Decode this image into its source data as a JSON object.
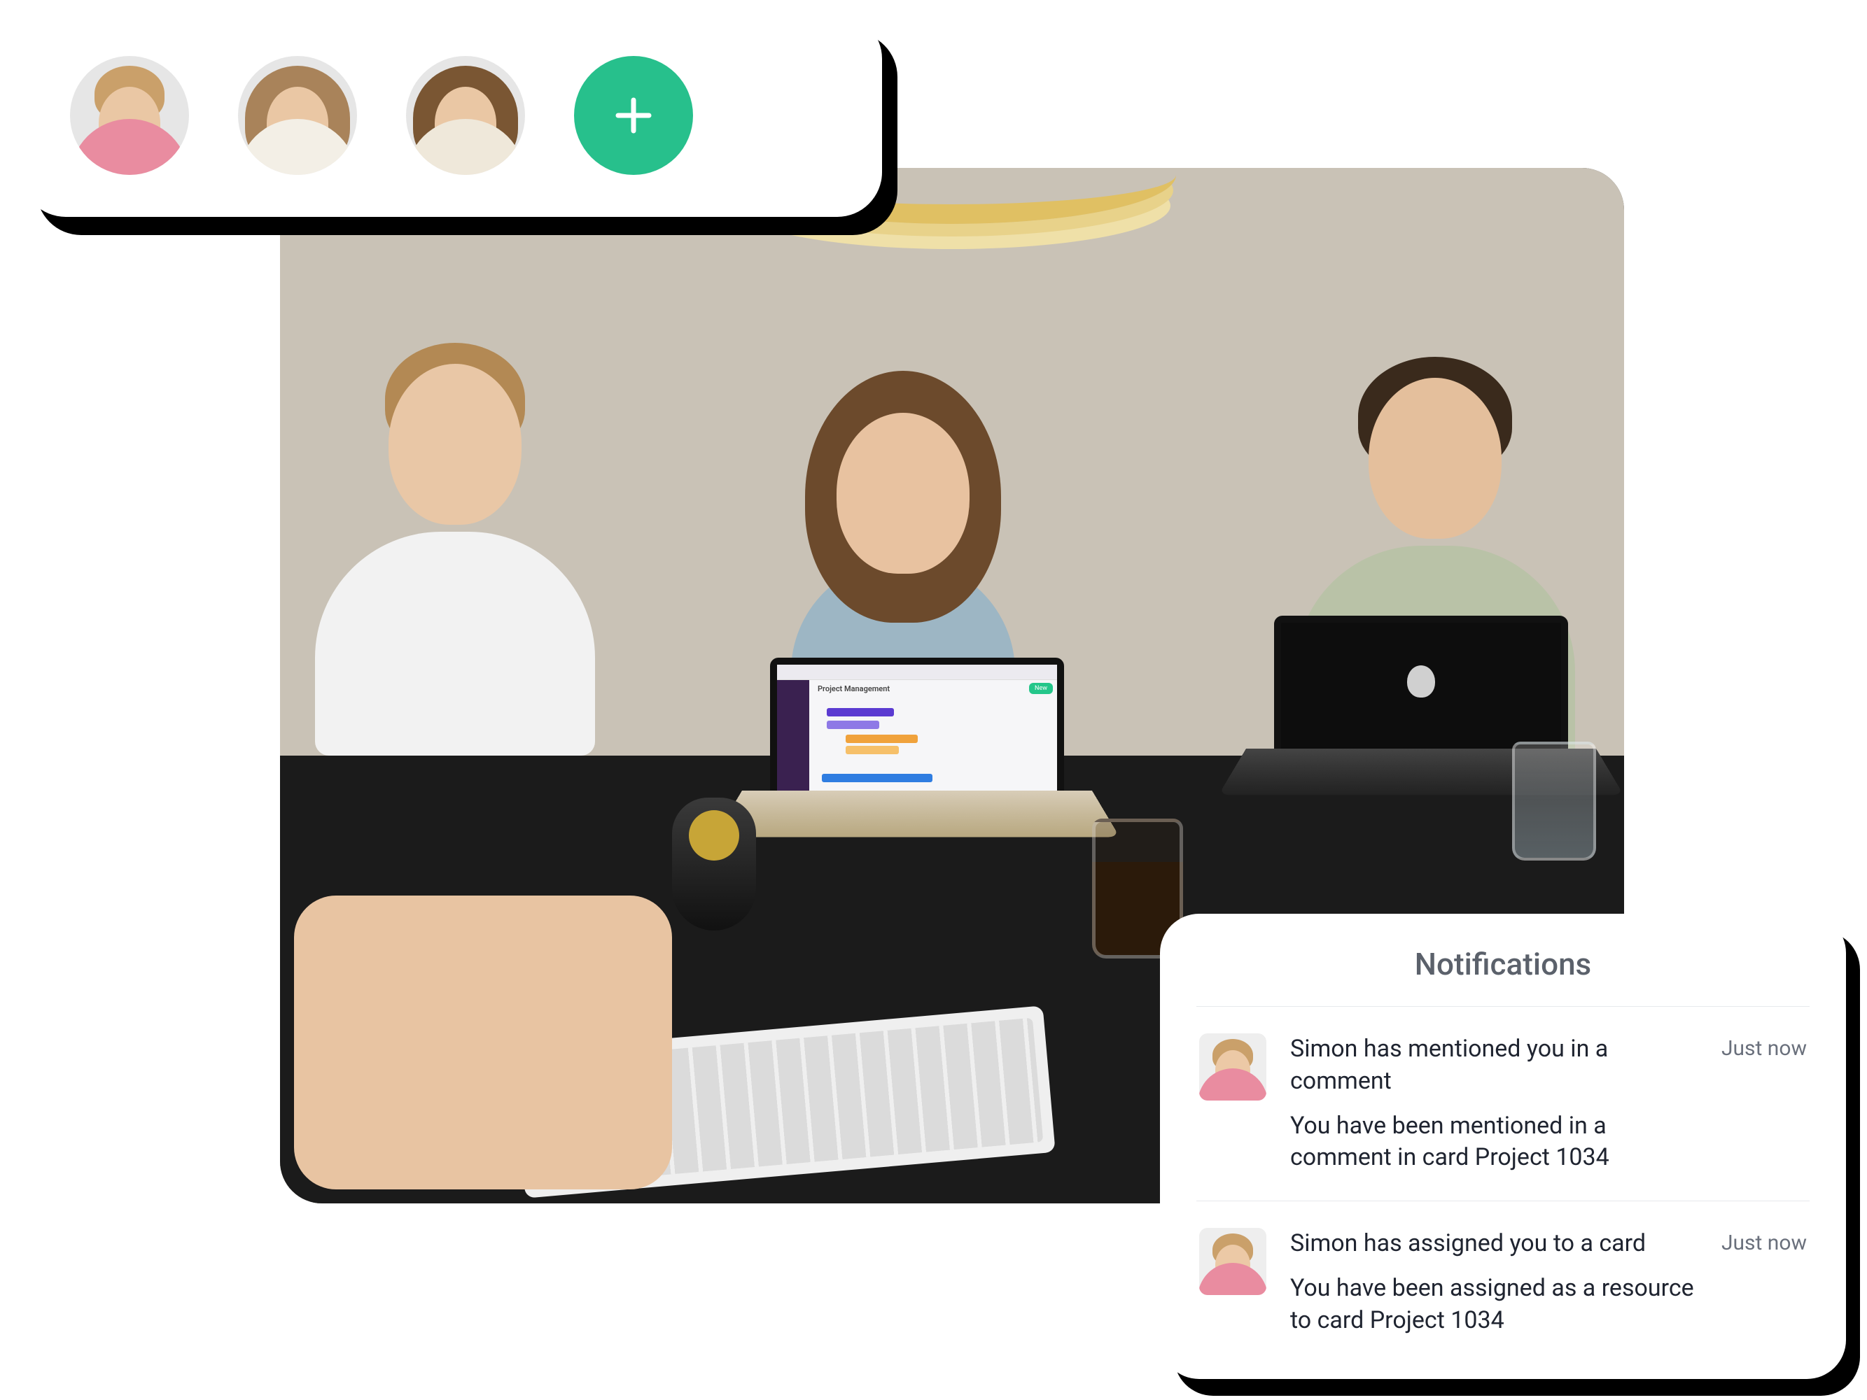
{
  "colors": {
    "accent_green": "#27c08c",
    "card_shadow": "#000000",
    "text_primary": "#1f2430",
    "text_muted": "#5b616b"
  },
  "avatar_bar": {
    "avatars": [
      {
        "name": "avatar-1"
      },
      {
        "name": "avatar-2"
      },
      {
        "name": "avatar-3"
      }
    ],
    "add_icon": "plus-icon"
  },
  "laptop_screen": {
    "page_title": "Project Management",
    "new_button": "New"
  },
  "notifications": {
    "title": "Notifications",
    "items": [
      {
        "heading": "Simon has mentioned you in a comment",
        "body": "You have been mentioned in a comment in card Project 1034",
        "time": "Just now"
      },
      {
        "heading": "Simon has assigned you to a card",
        "body": "You have been assigned as a resource to card Project 1034",
        "time": "Just now"
      }
    ]
  }
}
